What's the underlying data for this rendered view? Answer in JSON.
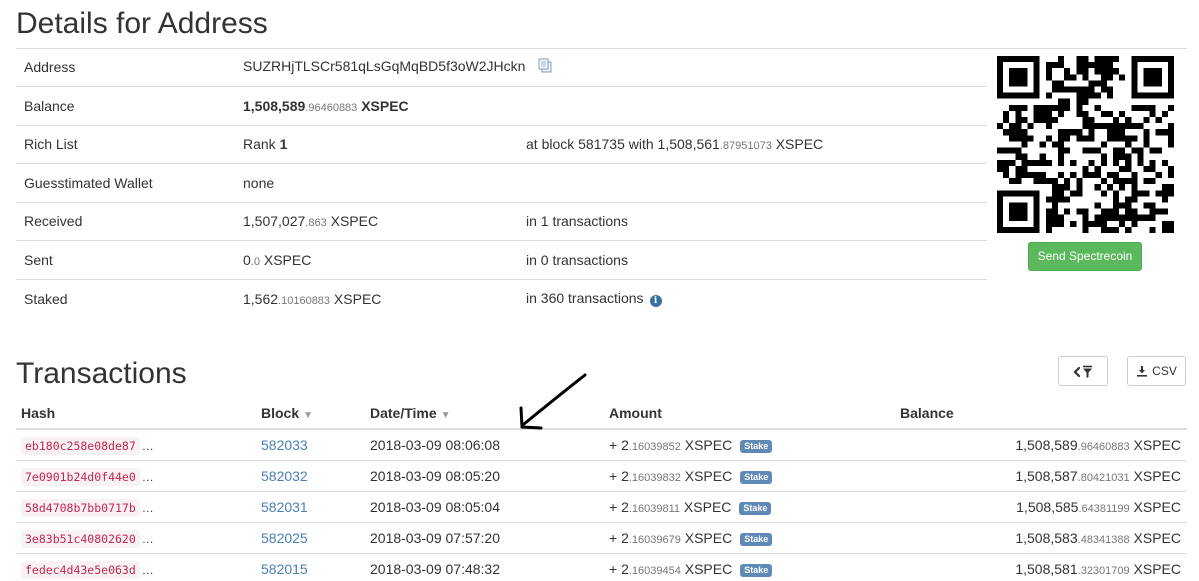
{
  "page_title": "Details for Address",
  "details": {
    "address": {
      "label": "Address",
      "value": "SUZRHjTLSCr581qLsGqMqBD5f3oW2JHckn"
    },
    "balance": {
      "label": "Balance",
      "int": "1,508,589",
      "dec": ".96460883",
      "unit": "XSPEC"
    },
    "rich_list": {
      "label": "Rich List",
      "rank_text": "Rank ",
      "rank": "1",
      "extra_prefix": "at block 581735 with 1,508,561",
      "extra_dec": ".87951073",
      "extra_unit": " XSPEC"
    },
    "wallet": {
      "label": "Guesstimated Wallet",
      "value": "none"
    },
    "received": {
      "label": "Received",
      "int": "1,507,027",
      "dec": ".863",
      "unit": " XSPEC",
      "extra": "in 1 transactions"
    },
    "sent": {
      "label": "Sent",
      "int": "0",
      "dec": ".0",
      "unit": " XSPEC",
      "extra": "in 0 transactions"
    },
    "staked": {
      "label": "Staked",
      "int": "1,562",
      "dec": ".10160883",
      "unit": " XSPEC",
      "extra": "in 360 transactions"
    }
  },
  "send_button": "Send Spectrecoin",
  "transactions": {
    "title": "Transactions",
    "csv_label": "CSV",
    "columns": {
      "hash": "Hash",
      "block": "Block",
      "datetime": "Date/Time",
      "amount": "Amount",
      "balance": "Balance"
    },
    "rows": [
      {
        "hash": "eb180c258e08de87",
        "block": "582033",
        "datetime": "2018-03-09 08:06:08",
        "amount_int": "+ 2",
        "amount_dec": ".16039852",
        "amount_unit": " XSPEC",
        "badge": "Stake",
        "balance_int": "1,508,589",
        "balance_dec": ".96460883",
        "balance_unit": " XSPEC"
      },
      {
        "hash": "7e0901b24d0f44e0",
        "block": "582032",
        "datetime": "2018-03-09 08:05:20",
        "amount_int": "+ 2",
        "amount_dec": ".16039832",
        "amount_unit": " XSPEC",
        "badge": "Stake",
        "balance_int": "1,508,587",
        "balance_dec": ".80421031",
        "balance_unit": " XSPEC"
      },
      {
        "hash": "58d4708b7bb0717b",
        "block": "582031",
        "datetime": "2018-03-09 08:05:04",
        "amount_int": "+ 2",
        "amount_dec": ".16039811",
        "amount_unit": " XSPEC",
        "badge": "Stake",
        "balance_int": "1,508,585",
        "balance_dec": ".64381199",
        "balance_unit": " XSPEC"
      },
      {
        "hash": "3e83b51c40802620",
        "block": "582025",
        "datetime": "2018-03-09 07:57:20",
        "amount_int": "+ 2",
        "amount_dec": ".16039679",
        "amount_unit": " XSPEC",
        "badge": "Stake",
        "balance_int": "1,508,583",
        "balance_dec": ".48341388",
        "balance_unit": " XSPEC"
      },
      {
        "hash": "fedec4d43e5e063d",
        "block": "582015",
        "datetime": "2018-03-09 07:48:32",
        "amount_int": "+ 2",
        "amount_dec": ".16039454",
        "amount_unit": " XSPEC",
        "badge": "Stake",
        "balance_int": "1,508,581",
        "balance_dec": ".32301709",
        "balance_unit": " XSPEC"
      }
    ]
  },
  "colors": {
    "accent_green": "#5cb85c",
    "link_blue": "#4a7fb5",
    "hash_red": "#c7254e",
    "badge_blue": "#5f8ab8"
  },
  "icons": {
    "copy": "copy-icon",
    "info": "info-icon",
    "qr": "qr-code",
    "filter": "chevron-filter-icon",
    "download": "download-icon",
    "annotation": "arrow-annotation"
  }
}
